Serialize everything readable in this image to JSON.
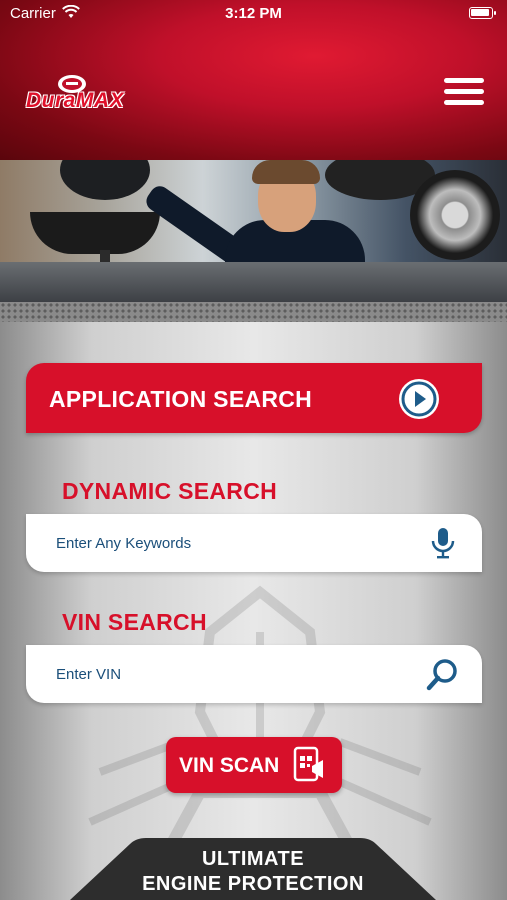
{
  "status_bar": {
    "carrier": "Carrier",
    "time": "3:12 PM"
  },
  "header": {
    "logo_text": "DuraMAX",
    "menu_icon": "hamburger-menu-icon"
  },
  "hero": {
    "image_description": "mechanic-under-car-photo"
  },
  "application_search": {
    "label": "APPLICATION SEARCH",
    "icon": "play-circle-icon"
  },
  "dynamic_search": {
    "title": "DYNAMIC SEARCH",
    "placeholder": "Enter Any Keywords",
    "value": "",
    "icon": "microphone-icon"
  },
  "vin_search": {
    "title": "VIN SEARCH",
    "placeholder": "Enter VIN",
    "value": "",
    "icon": "search-icon"
  },
  "vin_scan": {
    "label": "VIN SCAN",
    "icon": "phone-scan-icon"
  },
  "banner": {
    "line1": "ULTIMATE",
    "line2": "ENGINE PROTECTION"
  },
  "colors": {
    "brand_red": "#d7102a",
    "text_blue": "#1b4f7a",
    "icon_blue": "#1e5c8a"
  }
}
